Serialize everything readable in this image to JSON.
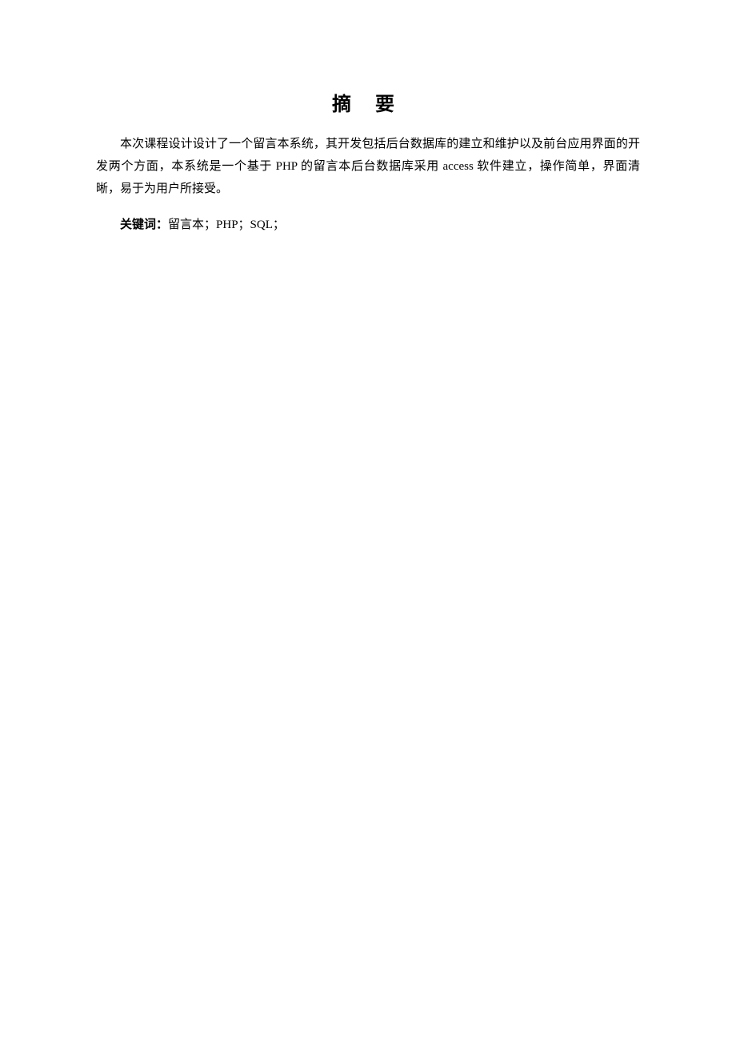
{
  "title": "摘 要",
  "abstract": "本次课程设计设计了一个留言本系统，其开发包括后台数据库的建立和维护以及前台应用界面的开发两个方面，本系统是一个基于 PHP 的留言本后台数据库采用 access 软件建立，操作简单，界面清晰，易于为用户所接受。",
  "keywords_label": "关键词：",
  "keywords_text": "留言本；PHP；SQL；"
}
